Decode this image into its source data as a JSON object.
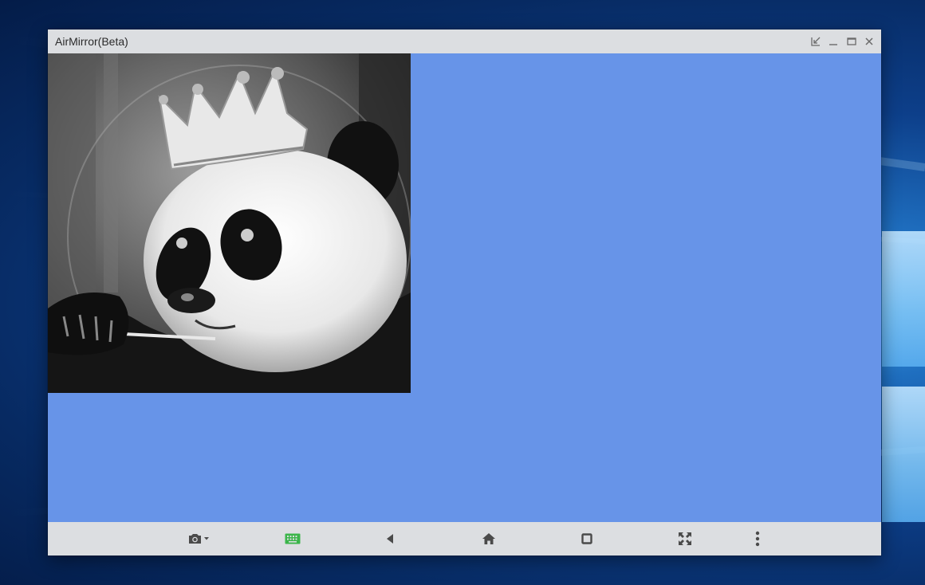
{
  "window": {
    "title": "AirMirror(Beta)"
  },
  "title_controls": [
    {
      "name": "pop-out-icon"
    },
    {
      "name": "minimize-icon"
    },
    {
      "name": "maximize-icon"
    },
    {
      "name": "close-icon"
    }
  ],
  "toolbar": {
    "items": [
      {
        "name": "screenshot-icon",
        "dropdown": true
      },
      {
        "name": "keyboard-icon",
        "active": true
      },
      {
        "name": "back-icon"
      },
      {
        "name": "home-icon"
      },
      {
        "name": "recent-apps-icon"
      },
      {
        "name": "fullscreen-icon"
      },
      {
        "name": "more-vertical-icon"
      }
    ]
  },
  "colors": {
    "title_bar": "#dcdee1",
    "phone_screen": "#6794e8",
    "icon_gray": "#5a5a5a",
    "keyboard_accent": "#3bb54a",
    "desktop_blue": "#0d3f8a"
  }
}
